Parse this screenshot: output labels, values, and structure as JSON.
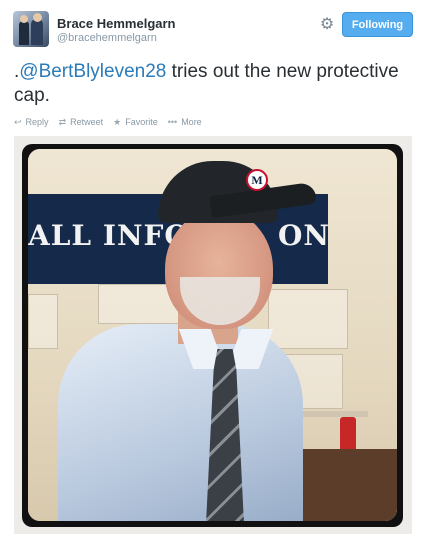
{
  "user": {
    "name": "Brace Hemmelgarn",
    "handle": "@bracehemmelgarn"
  },
  "header": {
    "follow_label": "Following",
    "settings_icon": "gear-icon"
  },
  "tweet": {
    "prefix": ".",
    "mention": "@BertBlyleven28",
    "text_after_mention": " tries out the new protective cap."
  },
  "actions": {
    "reply_label": "Reply",
    "retweet_label": "Retweet",
    "favorite_label": "Favorite",
    "more_label": "More"
  },
  "photo": {
    "banner_text_left": "ALL INFO",
    "banner_text_right": "ON",
    "cap_logo_letter": "M"
  },
  "colors": {
    "follow_button": "#55acee",
    "mention_link": "#2b7bb9",
    "muted_text": "#8899a6"
  }
}
